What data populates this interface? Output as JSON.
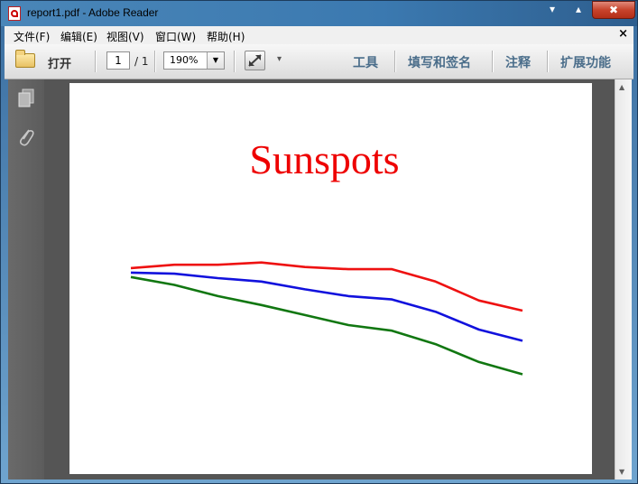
{
  "window": {
    "title": "report1.pdf - Adobe Reader",
    "controls": {
      "minimize": "▾",
      "maximize": "▴",
      "close": "✖"
    }
  },
  "menu": {
    "items": [
      "文件(F)",
      "编辑(E)",
      "视图(V)",
      "窗口(W)",
      "帮助(H)"
    ],
    "close": "×"
  },
  "toolbar": {
    "open_label": "打开",
    "page_current": "1",
    "page_total": "/ 1",
    "zoom": "190%",
    "links": [
      "工具",
      "填写和签名",
      "注释",
      "扩展功能"
    ]
  },
  "chart_data": {
    "type": "line",
    "title": "Sunspots",
    "x": [
      0,
      1,
      2,
      3,
      4,
      5,
      6,
      7,
      8,
      9
    ],
    "series": [
      {
        "color": "#ee1111",
        "values": [
          0.97,
          1.0,
          1.0,
          1.02,
          0.98,
          0.96,
          0.96,
          0.85,
          0.68,
          0.59
        ]
      },
      {
        "color": "#1111dd",
        "values": [
          0.93,
          0.92,
          0.88,
          0.85,
          0.78,
          0.72,
          0.69,
          0.58,
          0.42,
          0.32
        ]
      },
      {
        "color": "#117711",
        "values": [
          0.89,
          0.82,
          0.72,
          0.64,
          0.55,
          0.46,
          0.41,
          0.29,
          0.13,
          0.02
        ]
      }
    ],
    "ylim": [
      0,
      1.05
    ],
    "grid": false,
    "axes_visible": false
  }
}
